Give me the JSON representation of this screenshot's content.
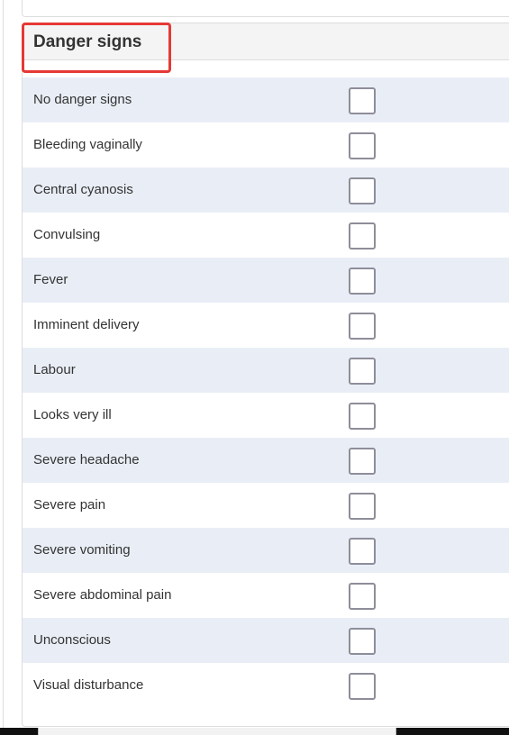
{
  "section": {
    "title": "Danger signs",
    "items": [
      {
        "label": "No danger signs",
        "checked": false
      },
      {
        "label": "Bleeding vaginally",
        "checked": false
      },
      {
        "label": "Central cyanosis",
        "checked": false
      },
      {
        "label": "Convulsing",
        "checked": false
      },
      {
        "label": "Fever",
        "checked": false
      },
      {
        "label": "Imminent delivery",
        "checked": false
      },
      {
        "label": "Labour",
        "checked": false
      },
      {
        "label": "Looks very ill",
        "checked": false
      },
      {
        "label": "Severe headache",
        "checked": false
      },
      {
        "label": "Severe pain",
        "checked": false
      },
      {
        "label": "Severe vomiting",
        "checked": false
      },
      {
        "label": "Severe abdominal pain",
        "checked": false
      },
      {
        "label": "Unconscious",
        "checked": false
      },
      {
        "label": "Visual disturbance",
        "checked": false
      }
    ]
  },
  "colors": {
    "highlight": "#e53935",
    "row_alt": "#e9eef6",
    "header_bg": "#f4f4f4"
  }
}
